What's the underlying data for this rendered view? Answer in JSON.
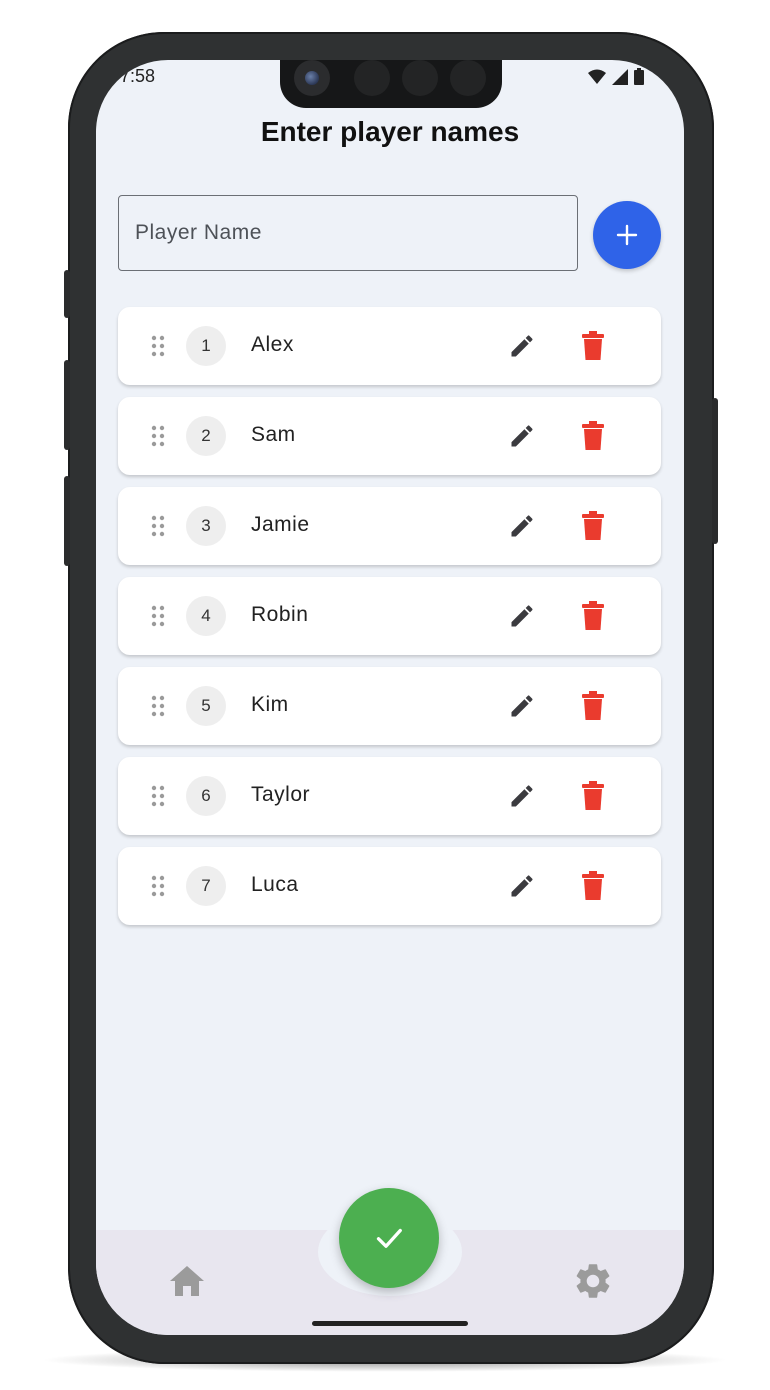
{
  "status": {
    "time": "7:58"
  },
  "header": {
    "title": "Enter player names"
  },
  "input": {
    "placeholder": "Player Name",
    "value": ""
  },
  "players": [
    {
      "number": "1",
      "name": "Alex"
    },
    {
      "number": "2",
      "name": "Sam"
    },
    {
      "number": "3",
      "name": "Jamie"
    },
    {
      "number": "4",
      "name": "Robin"
    },
    {
      "number": "5",
      "name": "Kim"
    },
    {
      "number": "6",
      "name": "Taylor"
    },
    {
      "number": "7",
      "name": "Luca"
    }
  ],
  "icons": {
    "add": "plus-icon",
    "confirm": "check-icon",
    "home": "home-icon",
    "settings": "gear-icon",
    "edit": "pencil-icon",
    "delete": "trash-icon",
    "drag": "drag-handle-icon"
  },
  "colors": {
    "accent": "#2f63e8",
    "confirm": "#4caf50",
    "delete": "#ea3b2e",
    "background": "#eef2f8"
  }
}
